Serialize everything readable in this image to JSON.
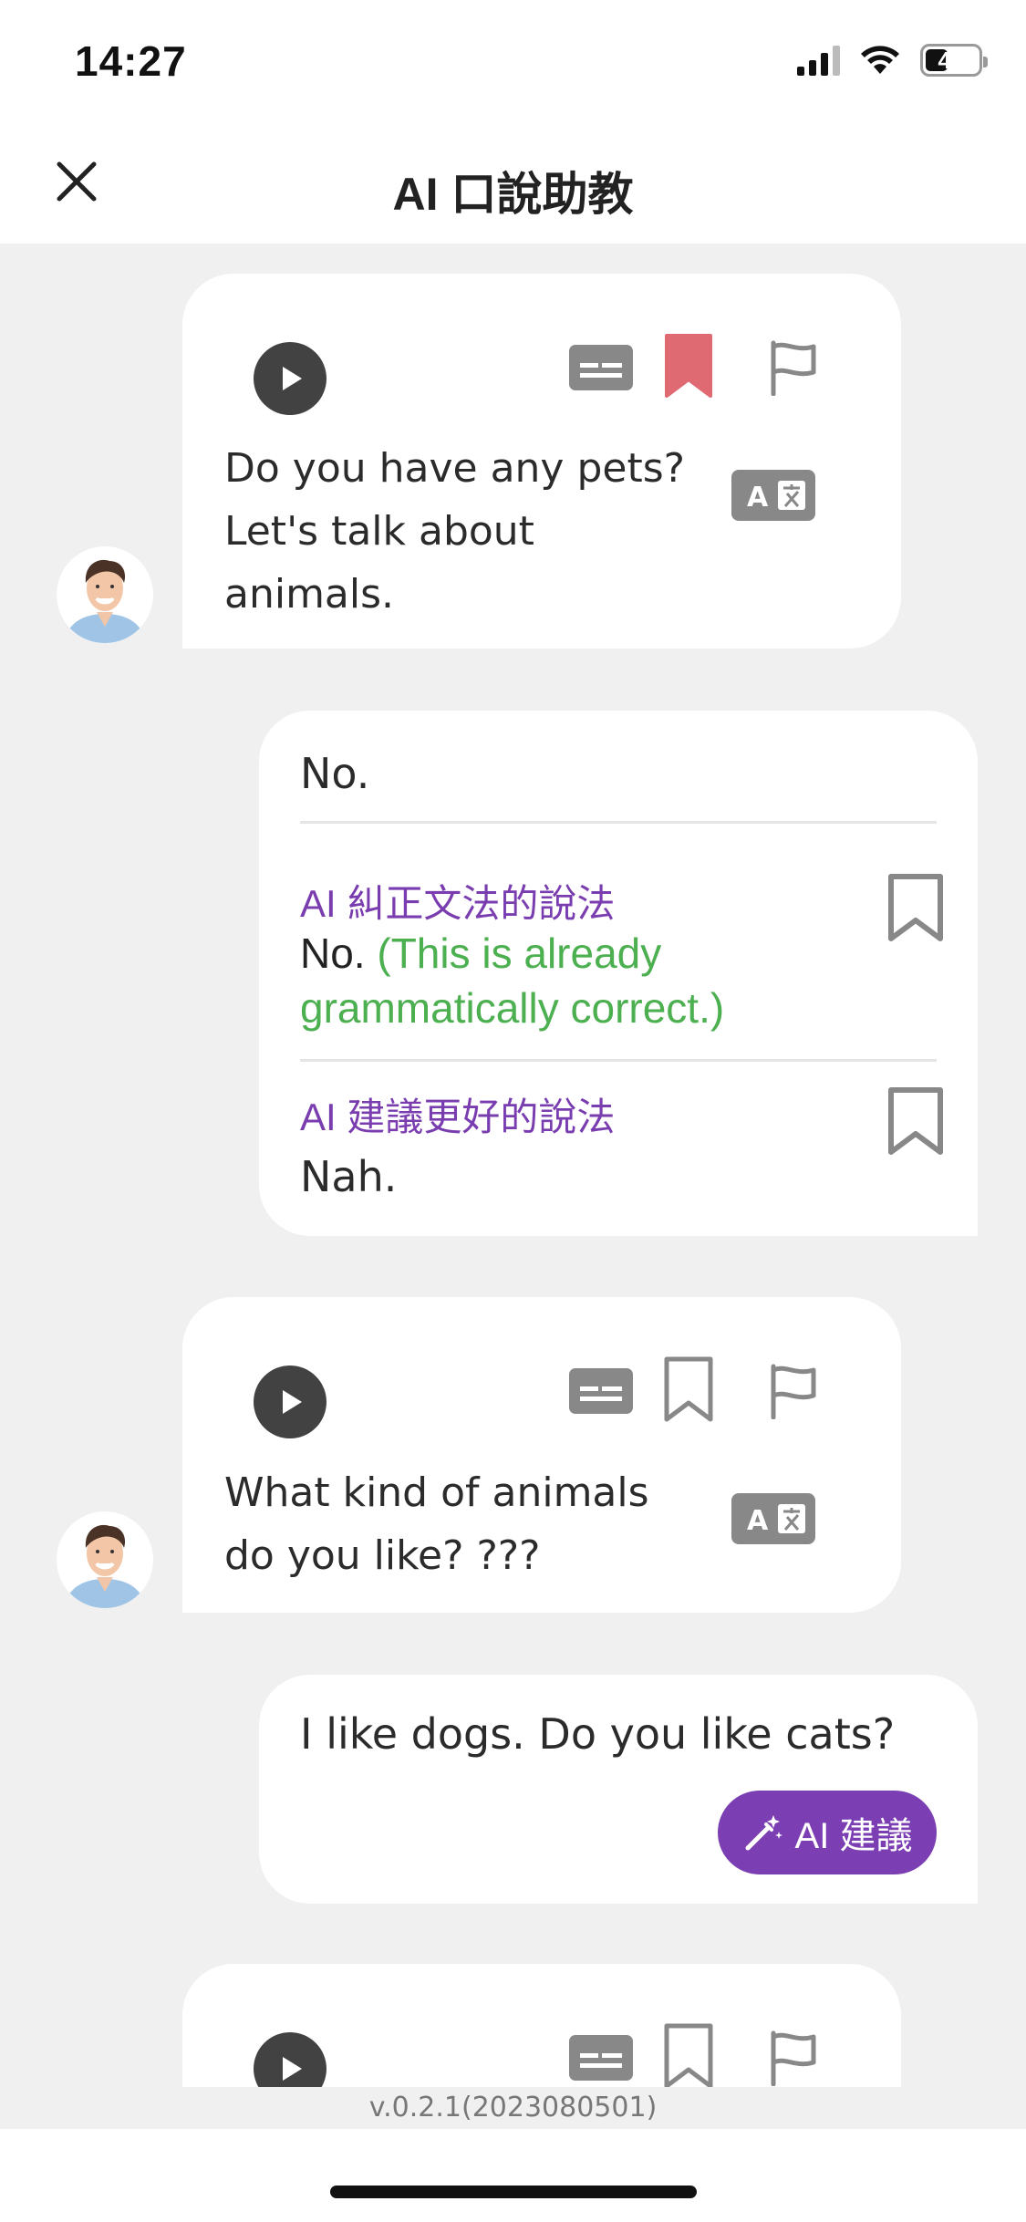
{
  "status_bar": {
    "time": "14:27",
    "battery": "49",
    "battery_level": 0.49,
    "icons": [
      "cellular-signal-icon",
      "wifi-icon",
      "battery-icon"
    ]
  },
  "header": {
    "title": "AI 口說助教",
    "close_icon": "close-icon"
  },
  "messages": [
    {
      "role": "ai",
      "text_lines": [
        "Do you have any pets?",
        "Let's talk about",
        "animals."
      ],
      "bookmarked": true,
      "icons": [
        "play-icon",
        "subtitle-icon",
        "bookmark-icon",
        "flag-icon",
        "translate-icon"
      ]
    },
    {
      "role": "user",
      "text": "No.",
      "grammar_label": "AI 糾正文法的說法",
      "grammar_text": "No.",
      "grammar_note_lines": [
        "(This is already",
        "grammatically correct.)"
      ],
      "better_label": "AI 建議更好的說法",
      "better_text": "Nah."
    },
    {
      "role": "ai",
      "text_lines": [
        "What kind of animals",
        "do you like? ???"
      ],
      "bookmarked": false,
      "icons": [
        "play-icon",
        "subtitle-icon",
        "bookmark-icon",
        "flag-icon",
        "translate-icon"
      ]
    },
    {
      "role": "user",
      "text": "I like dogs. Do you like cats?",
      "suggest_button": "AI 建議"
    },
    {
      "role": "ai",
      "text_lines": [],
      "bookmarked": false,
      "icons": [
        "play-icon",
        "subtitle-icon",
        "bookmark-icon",
        "flag-icon"
      ]
    }
  ],
  "footer": {
    "version": "v.0.2.1(2023080501)"
  },
  "colors": {
    "accent_purple": "#7b3fb3",
    "label_purple": "#7a3db0",
    "correct_green": "#4caf50",
    "bookmark_active": "#e06a72",
    "chat_background": "#f0f0f0"
  }
}
